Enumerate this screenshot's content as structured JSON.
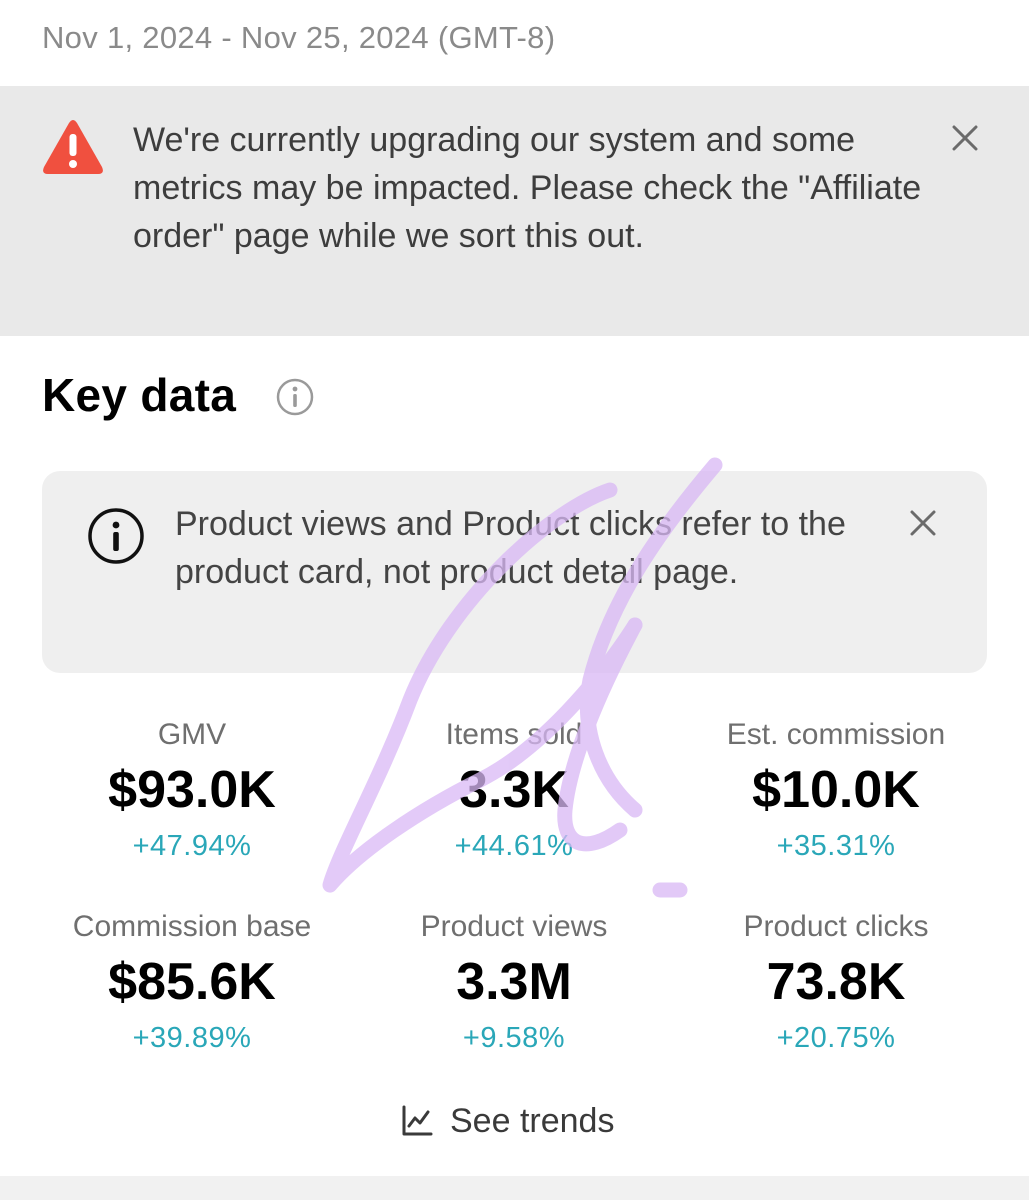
{
  "date_range": "Nov 1, 2024 - Nov 25, 2024 (GMT-8)",
  "system_banner": {
    "message": "We're currently upgrading our system and some metrics may be impacted. Please check the \"Affiliate order\" page while we sort this out.",
    "icon": "warning-icon",
    "close_icon": "close-icon"
  },
  "key_data": {
    "title": "Key data",
    "info_icon": "info-icon"
  },
  "notice": {
    "message": "Product views and Product clicks refer to the product card, not product detail page.",
    "icon": "info-icon",
    "close_icon": "close-icon"
  },
  "metrics": [
    {
      "label": "GMV",
      "value": "$93.0K",
      "change": "+47.94%"
    },
    {
      "label": "Items sold",
      "value": "3.3K",
      "change": "+44.61%"
    },
    {
      "label": "Est. commission",
      "value": "$10.0K",
      "change": "+35.31%"
    },
    {
      "label": "Commission base",
      "value": "$85.6K",
      "change": "+39.89%"
    },
    {
      "label": "Product views",
      "value": "3.3M",
      "change": "+9.58%"
    },
    {
      "label": "Product clicks",
      "value": "73.8K",
      "change": "+20.75%"
    }
  ],
  "see_trends": {
    "label": "See trends",
    "icon": "line-chart-icon"
  },
  "colors": {
    "warning": "#f0503f",
    "positive_change": "#2aa7b8",
    "banner_background": "#e9e9e9",
    "card_background": "#efefef",
    "signature": "#d9b8f5"
  }
}
